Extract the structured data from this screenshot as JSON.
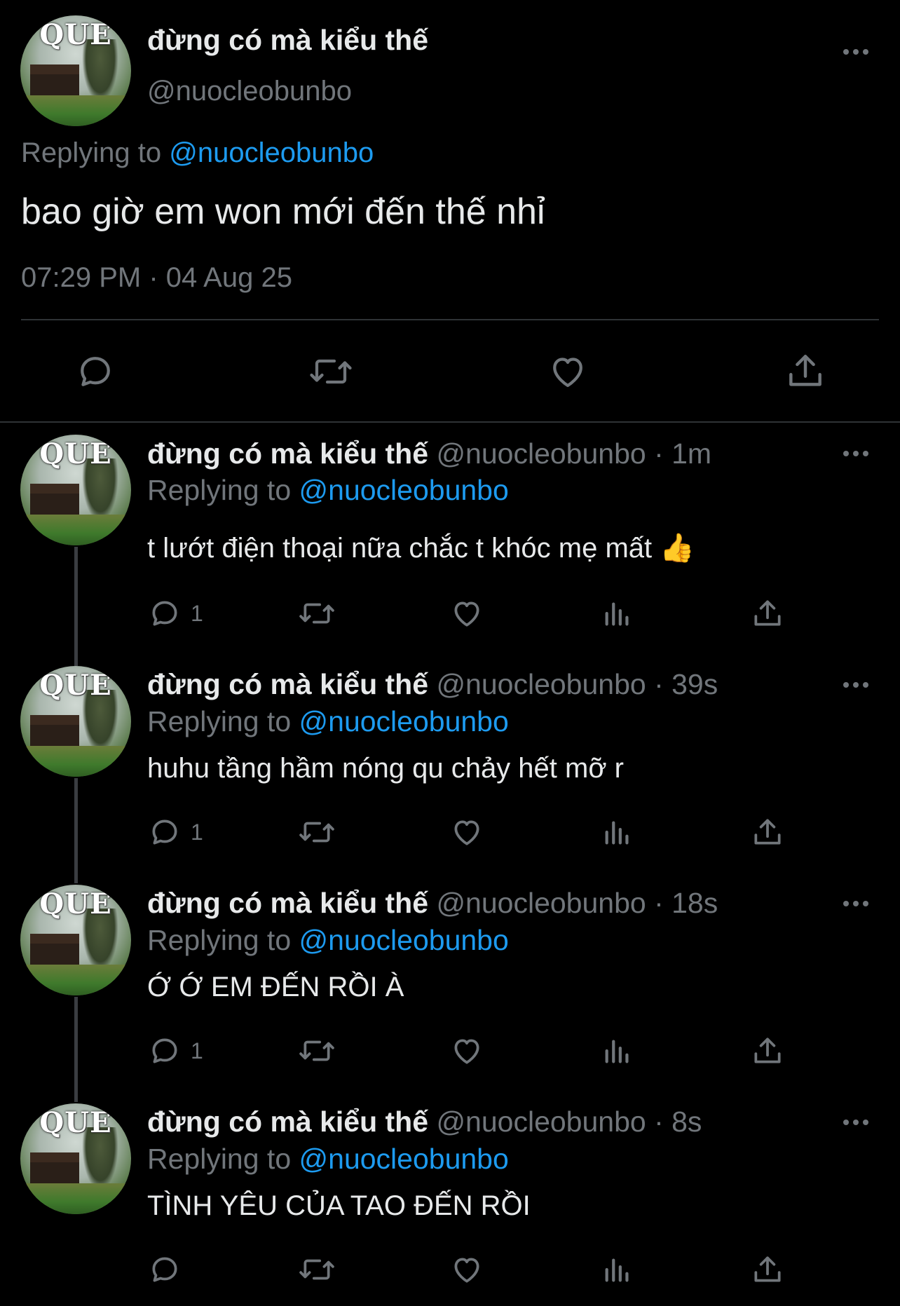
{
  "main_tweet": {
    "display_name": "đừng có mà kiểu thế",
    "handle": "@nuocleobunbo",
    "replying_prefix": "Replying to",
    "replying_handle": "@nuocleobunbo",
    "text": "bao giờ em won mới đến thế nhỉ",
    "timestamp": "07:29 PM · 04 Aug 25"
  },
  "avatar_text": "QUE",
  "replies": [
    {
      "display_name": "đừng có mà kiểu thế",
      "handle_time": "@nuocleobunbo · 1m",
      "replying_prefix": "Replying to",
      "replying_handle": "@nuocleobunbo",
      "text": "t lướt điện thoại nữa chắc t khóc mẹ mất 👍",
      "reply_count": "1"
    },
    {
      "display_name": "đừng có mà kiểu thế",
      "handle_time": "@nuocleobunbo · 39s",
      "replying_prefix": "Replying to",
      "replying_handle": "@nuocleobunbo",
      "text": "huhu tầng hầm nóng qu chảy hết mỡ r",
      "reply_count": "1"
    },
    {
      "display_name": "đừng có mà kiểu thế",
      "handle_time": "@nuocleobunbo · 18s",
      "replying_prefix": "Replying to",
      "replying_handle": "@nuocleobunbo",
      "text": "Ớ Ớ EM ĐẾN RỒI À",
      "reply_count": "1"
    },
    {
      "display_name": "đừng có mà kiểu thế",
      "handle_time": "@nuocleobunbo · 8s",
      "replying_prefix": "Replying to",
      "replying_handle": "@nuocleobunbo",
      "text": "TÌNH YÊU CỦA TAO ĐẾN RỒI",
      "reply_count": ""
    }
  ],
  "colors": {
    "background": "#000000",
    "text": "#e7e9ea",
    "muted": "#71767b",
    "link": "#1d9bf0"
  },
  "icons": [
    "reply-icon",
    "retweet-icon",
    "like-icon",
    "views-icon",
    "share-icon",
    "more-icon"
  ]
}
